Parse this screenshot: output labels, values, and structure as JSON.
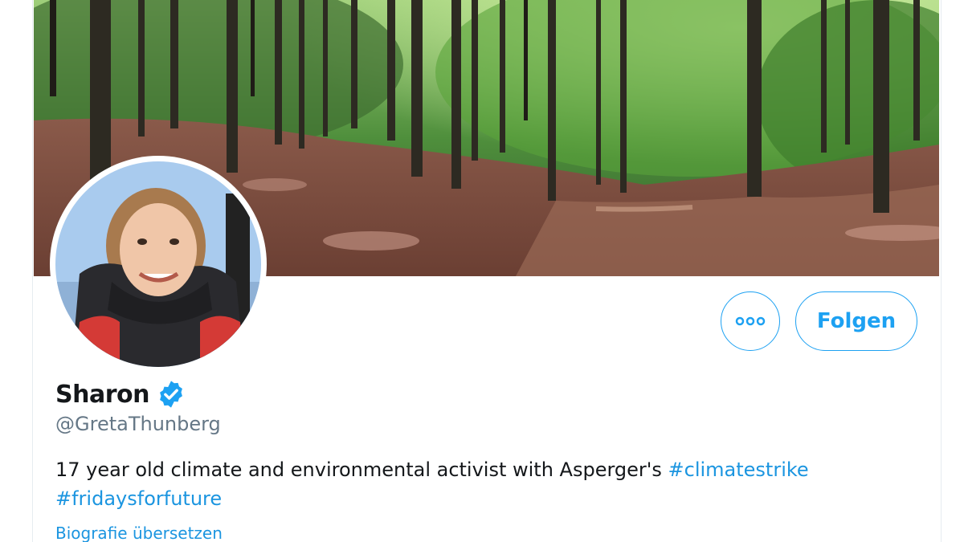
{
  "profile": {
    "display_name": "Sharon",
    "handle": "@GretaThunberg",
    "bio_text": "17 year old climate and environmental activist with Asperger's ",
    "bio_hashtags": [
      "#climatestrike",
      "#fridaysforfuture"
    ],
    "translate_label": "Biografie übersetzen"
  },
  "actions": {
    "more_icon": "more-dots-icon",
    "follow_label": "Folgen"
  },
  "icons": {
    "verified": "verified-badge-icon"
  },
  "colors": {
    "accent": "#1da1f2",
    "link": "#1b95e0",
    "text_primary": "#14171a",
    "text_secondary": "#657786"
  }
}
